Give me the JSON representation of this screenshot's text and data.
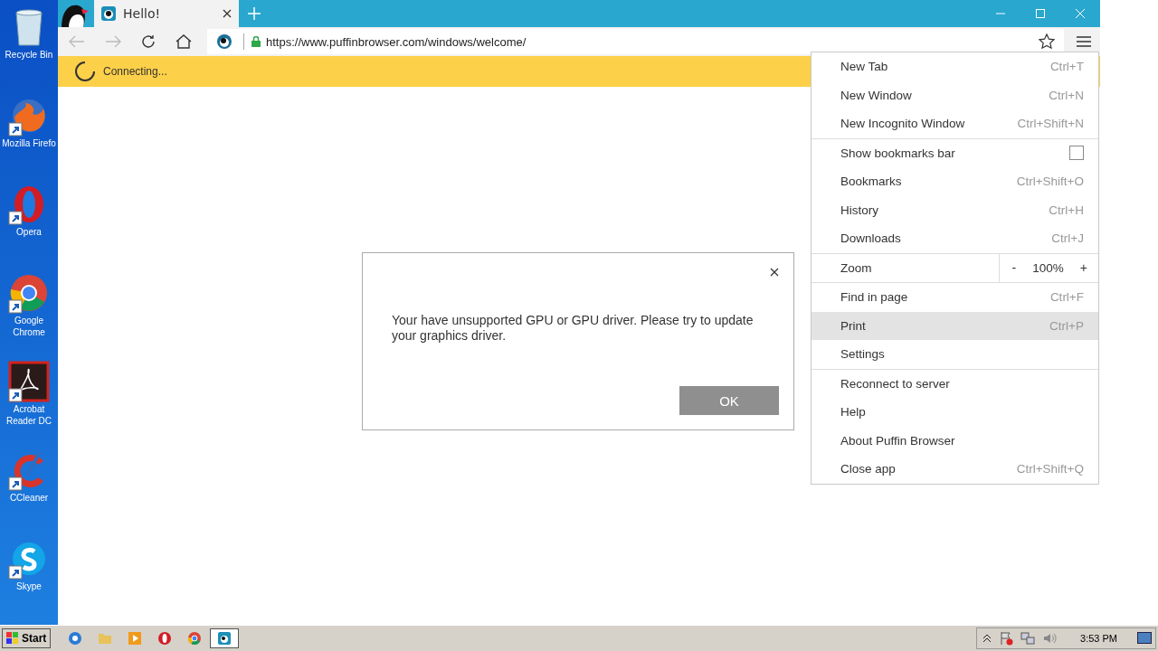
{
  "desktop_icons": [
    {
      "label": "Recycle Bin",
      "kind": "recycle"
    },
    {
      "label": "Mozilla Firefo",
      "kind": "firefox"
    },
    {
      "label": "Opera",
      "kind": "opera"
    },
    {
      "label": "Google Chrome",
      "kind": "chrome"
    },
    {
      "label": "Acrobat Reader DC",
      "kind": "acrobat"
    },
    {
      "label": "CCleaner",
      "kind": "ccleaner"
    },
    {
      "label": "Skype",
      "kind": "skype"
    }
  ],
  "browser": {
    "tabs": [
      {
        "title": "Hello!",
        "selected": true
      }
    ],
    "address": "https://www.puffinbrowser.com/windows/welcome/",
    "status": "Connecting..."
  },
  "menu": {
    "sections": [
      {
        "items": [
          {
            "kind": "item",
            "label": "New Tab",
            "shortcut": "Ctrl+T",
            "highlighted": false
          },
          {
            "kind": "item",
            "label": "New Window",
            "shortcut": "Ctrl+N",
            "highlighted": false
          },
          {
            "kind": "item",
            "label": "New Incognito Window",
            "shortcut": "Ctrl+Shift+N",
            "highlighted": false
          }
        ]
      },
      {
        "items": [
          {
            "kind": "checkbox",
            "label": "Show bookmarks bar",
            "checked": false,
            "highlighted": false
          },
          {
            "kind": "item",
            "label": "Bookmarks",
            "shortcut": "Ctrl+Shift+O",
            "highlighted": false
          },
          {
            "kind": "item",
            "label": "History",
            "shortcut": "Ctrl+H",
            "highlighted": false
          },
          {
            "kind": "item",
            "label": "Downloads",
            "shortcut": "Ctrl+J",
            "highlighted": false
          }
        ]
      },
      {
        "items": [
          {
            "kind": "zoom",
            "label": "Zoom",
            "minus": "-",
            "value": "100%",
            "plus": "+",
            "highlighted": false
          }
        ]
      },
      {
        "items": [
          {
            "kind": "item",
            "label": "Find in page",
            "shortcut": "Ctrl+F",
            "highlighted": false
          },
          {
            "kind": "item",
            "label": "Print",
            "shortcut": "Ctrl+P",
            "highlighted": true
          },
          {
            "kind": "item",
            "label": "Settings",
            "highlighted": false
          }
        ]
      },
      {
        "items": [
          {
            "kind": "item",
            "label": "Reconnect to server",
            "highlighted": false
          },
          {
            "kind": "item",
            "label": "Help",
            "highlighted": false
          },
          {
            "kind": "item",
            "label": "About Puffin Browser",
            "highlighted": false
          },
          {
            "kind": "item",
            "label": "Close app",
            "shortcut": "Ctrl+Shift+Q",
            "highlighted": false
          }
        ]
      }
    ]
  },
  "dialog": {
    "message": "Your have unsupported GPU or GPU driver. Please try to update your graphics driver.",
    "button": "OK"
  },
  "taskbar": {
    "start": "Start",
    "apps": [
      {
        "kind": "ie",
        "selected": false
      },
      {
        "kind": "folder",
        "selected": false
      },
      {
        "kind": "media",
        "selected": false
      },
      {
        "kind": "opera",
        "selected": false
      },
      {
        "kind": "chrome",
        "selected": false
      },
      {
        "kind": "puffin",
        "selected": true
      }
    ],
    "clock": "3:53 PM"
  }
}
